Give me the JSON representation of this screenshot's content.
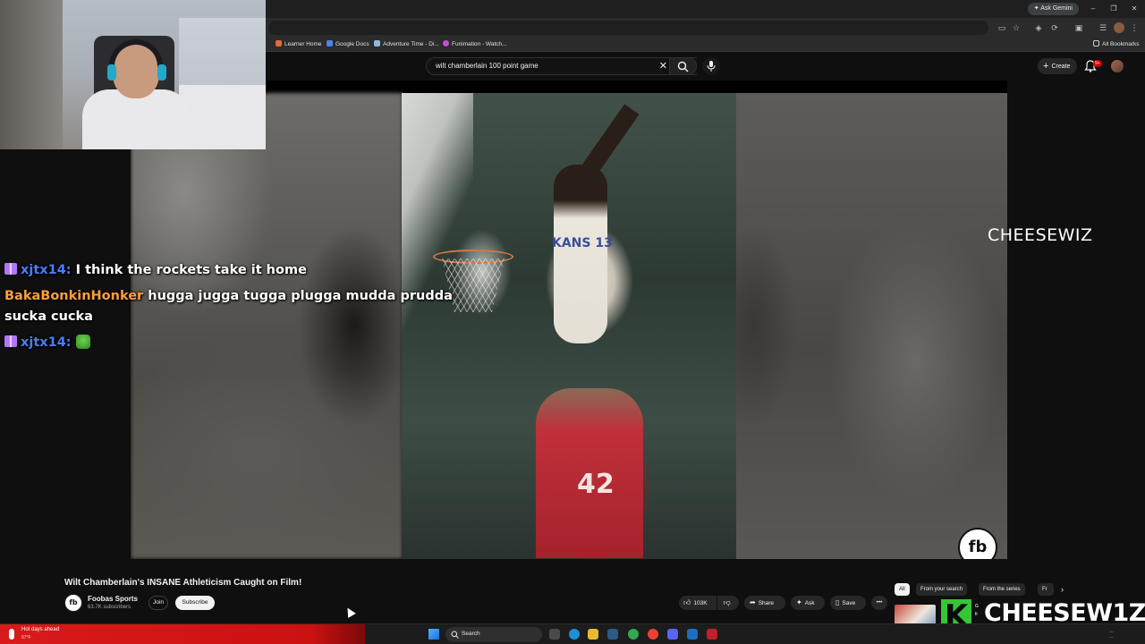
{
  "browser": {
    "ask_gemini_label": "Ask Gemini",
    "bookmarks": [
      {
        "label": "Learner Home",
        "color": "#e06a3b"
      },
      {
        "label": "Google Docs",
        "color": "#4a86e8"
      },
      {
        "label": "Adventure Time - Di...",
        "color": "#8fb8de"
      },
      {
        "label": "Funimation - Watch...",
        "color": "#c24dd6"
      }
    ],
    "all_bookmarks_label": "All Bookmarks"
  },
  "youtube": {
    "search_query": "wilt chamberlain 100 point game",
    "create_label": "Create",
    "notification_count": "9+"
  },
  "chat": [
    {
      "badge": "gift",
      "user": "xjtx14:",
      "user_color": "#4a7cff",
      "message": "I think the rockets take it home"
    },
    {
      "badge": "none",
      "user": "BakaBonkinHonker",
      "user_color": "#ff9f3a",
      "message": "hugga jugga tugga plugga mudda prudda"
    },
    {
      "badge": "none",
      "user": "",
      "message": "sucka cucka"
    },
    {
      "badge": "gift",
      "user": "xjtx14:",
      "user_color": "#4a7cff",
      "message": "",
      "emote": "green-smiley-emote"
    }
  ],
  "stream_overlay": {
    "name_label": "CHEESEWIZ",
    "brand_label": "CHEESEW1Z",
    "k_logo": "K",
    "k_logo_tag": "G fr"
  },
  "video": {
    "title": "Wilt Chamberlain's INSANE Athleticism Caught on Film!",
    "jersey_white": "KANS 13",
    "jersey_red": "42",
    "channel_logo": "fb",
    "channel_name": "Foobas Sports",
    "subscribers": "63.7K subscribers",
    "join_label": "Join",
    "subscribe_label": "Subscribe",
    "likes": "103K",
    "share_label": "Share",
    "ask_label": "Ask",
    "save_label": "Save"
  },
  "chips": [
    {
      "label": "All",
      "active": true
    },
    {
      "label": "From your search",
      "active": false
    },
    {
      "label": "From the series",
      "active": false
    },
    {
      "label": "Fr",
      "active": false
    }
  ],
  "taskbar": {
    "weather_title": "Hot days ahead",
    "weather_temp": "97°F",
    "search_label": "Search"
  },
  "colors": {
    "youtube_bg": "#0f0f0f",
    "subscribe_bg": "#f1f1f1",
    "weather_red": "#d91a1a",
    "k_green": "#35c635"
  }
}
